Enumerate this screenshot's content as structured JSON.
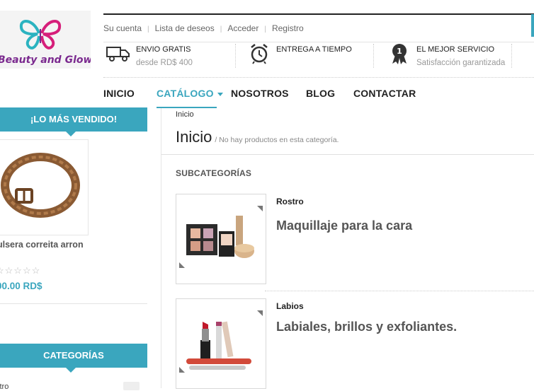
{
  "brand": {
    "name": "Beauty and Glow",
    "trademark": "®"
  },
  "top_links": [
    "Su cuenta",
    "Lista de deseos",
    "Acceder",
    "Registro"
  ],
  "features": [
    {
      "title": "ENVIO GRATIS",
      "subtitle": "desde RD$ 400",
      "icon": "truck-icon"
    },
    {
      "title": "ENTREGA A TIEMPO",
      "subtitle": "",
      "icon": "alarm-clock-icon"
    },
    {
      "title": "EL MEJOR SERVICIO",
      "subtitle": "Satisfacción garantizada",
      "icon": "award-badge-icon",
      "badge": "1"
    }
  ],
  "nav": [
    {
      "label": "INICIO"
    },
    {
      "label": "CATÁLOGO",
      "active": true
    },
    {
      "label": "NOSOTROS"
    },
    {
      "label": "BLOG"
    },
    {
      "label": "CONTACTAR"
    }
  ],
  "sidebar": {
    "bestsellers_title": "¡LO MÁS VENDIDO!",
    "product": {
      "name": "ulsera correita arron",
      "stars": "☆☆☆☆☆",
      "price": "00.00 RD$"
    },
    "categories_title": "CATEGORÍAS",
    "category_first": "stro"
  },
  "main": {
    "breadcrumb": "Inicio",
    "title": "Inicio",
    "subtitle": "/ No hay productos en esta categoría.",
    "subcategories_title": "SUBCATEGORÍAS",
    "subcategories": [
      {
        "name": "Rostro",
        "description": "Maquillaje para la cara"
      },
      {
        "name": "Labios",
        "description": "Labiales, brillos y exfoliantes."
      }
    ]
  },
  "colors": {
    "accent": "#3aa6be",
    "brand_purple": "#7b2a8f",
    "brand_pink": "#d61f7a",
    "brand_teal": "#2bb3c0"
  }
}
